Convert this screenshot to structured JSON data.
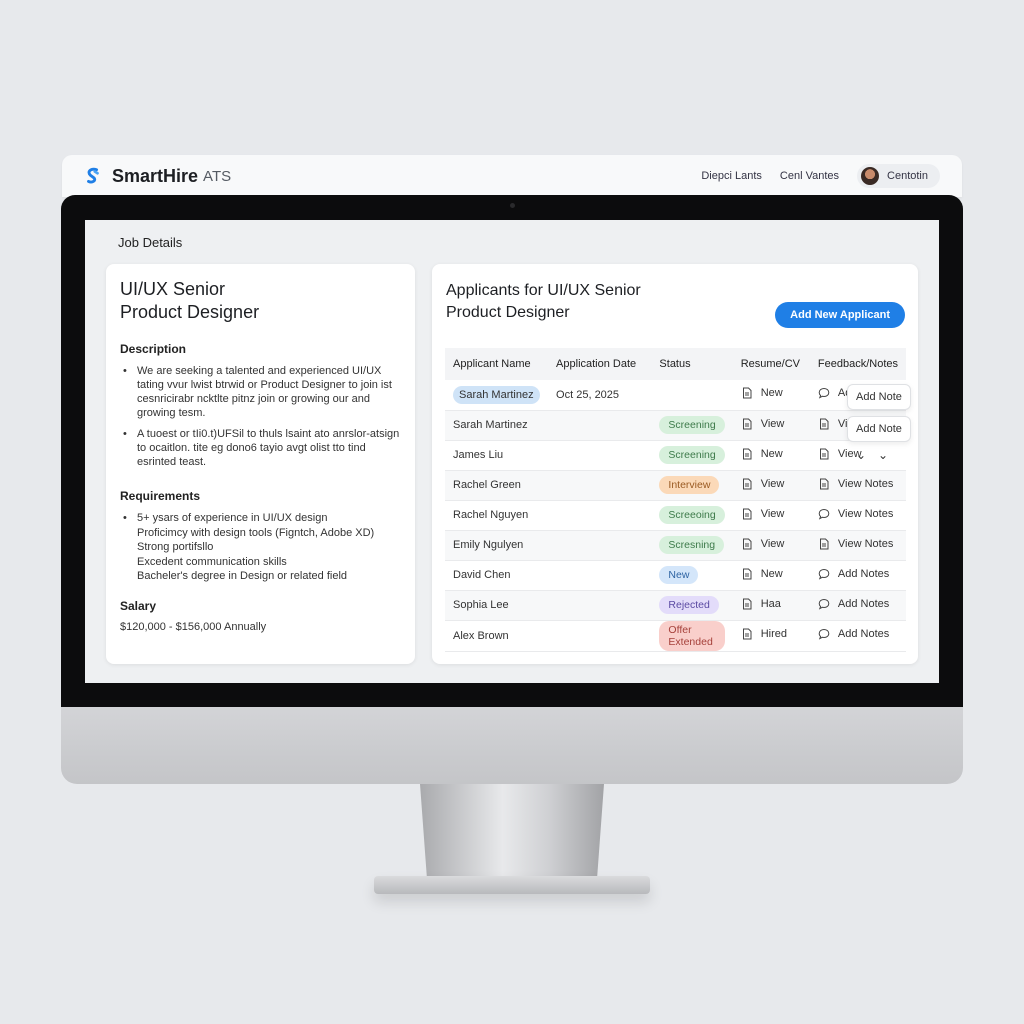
{
  "app": {
    "brand": "SmartHire",
    "brand_suffix": "ATS"
  },
  "topnav": {
    "links": [
      "Diepci Lants",
      "Cenl Vantes"
    ],
    "user": "Centotin"
  },
  "page": {
    "title": "Job Details"
  },
  "job": {
    "title": "UI/UX Senior Product Designer",
    "description_heading": "Description",
    "description": [
      "We are seeking a talented and experienced UI/UX tating vvur lwist btrwid or Product Designer to join ist cesnricirabr ncktlte pitnz join or growing our and growing tesm.",
      "A tuoest or tIi0.t)UFSil to thuls lsaint ato anrslor-atsign to ocaitlon. tite eg dono6 tayio avgt olist tto tind esrinted teast."
    ],
    "requirements_heading": "Requirements",
    "requirements": [
      "5+ ysars of experience in UI/UX design",
      "Proficimcy with design tools (Figntch, Adobe XD)",
      "Strong portifsllo",
      "Excedent communication skills",
      "Bacheler's degree in Design or related field"
    ],
    "salary_heading": "Salary",
    "salary": "$120,000 - $156,000 Annually"
  },
  "applicants": {
    "title": "Applicants for UI/UX Senior Product Designer",
    "add_button": "Add New Applicant",
    "columns": [
      "Applicant Name",
      "Application Date",
      "Status",
      "Resume/CV",
      "Feedback/Notes"
    ],
    "rows": [
      {
        "name": "Sarah Martinez",
        "date": "Oct 25, 2025",
        "status": "",
        "resume": "New",
        "notes": "Add Note",
        "notes_icon": "comment-icon",
        "highlight": true
      },
      {
        "name": "Sarah Martinez",
        "date": "",
        "status": "Screening",
        "resume": "View",
        "notes": "View",
        "notes_icon": "document-icon"
      },
      {
        "name": "James Liu",
        "date": "",
        "status": "Screening",
        "resume": "New",
        "notes": "View",
        "notes_icon": "document-icon"
      },
      {
        "name": "Rachel Green",
        "date": "",
        "status": "Interview",
        "resume": "View",
        "notes": "View Notes",
        "notes_icon": "document-icon"
      },
      {
        "name": "Rachel Nguyen",
        "date": "",
        "status": "Screeoing",
        "resume": "View",
        "notes": "View Notes",
        "notes_icon": "comment-icon"
      },
      {
        "name": "Emily Ngulyen",
        "date": "",
        "status": "Scresning",
        "resume": "View",
        "notes": "View Notes",
        "notes_icon": "document-icon"
      },
      {
        "name": "David Chen",
        "date": "",
        "status": "New",
        "resume": "New",
        "notes": "Add Notes",
        "notes_icon": "comment-icon"
      },
      {
        "name": "Sophia Lee",
        "date": "",
        "status": "Rejected",
        "resume": "Haa",
        "notes": "Add Notes",
        "notes_icon": "comment-icon"
      },
      {
        "name": "Alex Brown",
        "date": "",
        "status": "Offer Extended",
        "resume": "Hired",
        "notes": "Add Notes",
        "notes_icon": "comment-icon"
      }
    ],
    "popover_buttons": [
      "Add Note",
      "Add Note"
    ]
  },
  "colors": {
    "accent": "#1f7fe6",
    "status": {
      "Screening": {
        "bg": "#d7f0dc",
        "fg": "#3d7a4a"
      },
      "Screeoing": {
        "bg": "#d7f0dc",
        "fg": "#3d7a4a"
      },
      "Scresning": {
        "bg": "#d7f0dc",
        "fg": "#3d7a4a"
      },
      "Interview": {
        "bg": "#fbd9b8",
        "fg": "#9a5a22"
      },
      "New": {
        "bg": "#d4e6fa",
        "fg": "#2f64a3"
      },
      "Rejected": {
        "bg": "#e3dcfa",
        "fg": "#5b4aa3"
      },
      "Offer Extended": {
        "bg": "#f9cfcb",
        "fg": "#a5403a"
      }
    }
  }
}
